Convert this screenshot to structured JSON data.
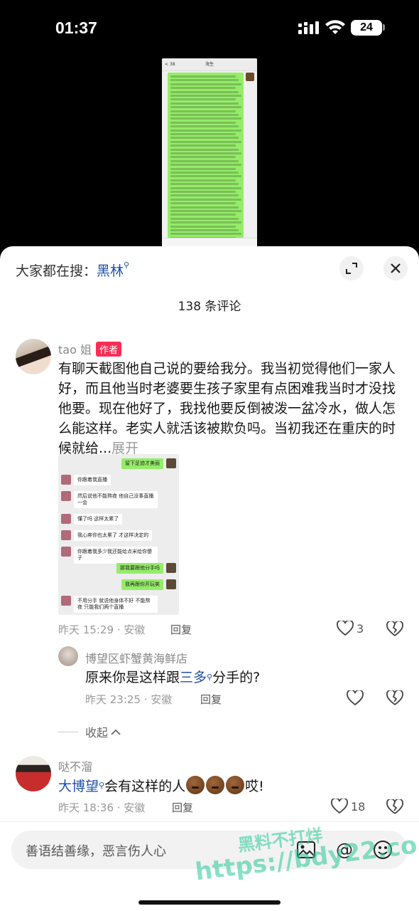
{
  "status": {
    "time": "01:37",
    "battery": "24"
  },
  "preview": {
    "title": "海生",
    "back": "< 38"
  },
  "sheet": {
    "search_prefix": "大家都在搜：",
    "search_keyword": "黑林",
    "comment_count": "138 条评论"
  },
  "comments": [
    {
      "user": "tao 姐",
      "badge": "作者",
      "text": "有聊天截图他自己说的要给我分。我当初觉得他们一家人好，而且他当时老婆要生孩子家里有点困难我当时才没找他要。现在他好了，我找他要反倒被泼一盆冷水，做人怎么能这样。老实人就活该被欺负吗。当初我还在重庆的时候就给...",
      "expand": "展开",
      "time_loc": "昨天 15:29 · 安徽",
      "reply": "回复",
      "likes": "3",
      "image_chat": [
        {
          "side": "right",
          "text": "留下足迹才美丽"
        },
        {
          "side": "left",
          "text": "你跟着我直播"
        },
        {
          "side": "left",
          "text": "然后说他不能熬夜 他自己没事直播一会"
        },
        {
          "side": "left",
          "text": "懂了吗 这样太累了"
        },
        {
          "side": "left",
          "text": "我心疼你也太累了 才这样决定的"
        },
        {
          "side": "left",
          "text": "你跟着我多少我还能给点米给你傻子"
        },
        {
          "side": "right",
          "text": "那我要跟他分手吗"
        },
        {
          "side": "right",
          "text": "我再跟你开玩笑"
        },
        {
          "side": "left",
          "text": "不用分手 就说他身体不好 不能熬夜 只能我们两个直播"
        }
      ]
    },
    {
      "user": "博望区虾蟹黄海鲜店",
      "text_prefix": "原来你是这样跟",
      "text_link": "三多",
      "text_suffix": "分手的?",
      "time_loc": "昨天 23:25 · 安徽",
      "reply": "回复"
    },
    {
      "user": "哒不溜",
      "text_link": "大博望",
      "text_mid": "会有这样的人",
      "text_suffix": "哎!",
      "time_loc": "昨天 18:36 · 安徽",
      "reply": "回复",
      "likes": "18"
    }
  ],
  "collapse": "收起",
  "input": {
    "placeholder": "善语结善缘，恶言伤人心"
  },
  "watermark": {
    "line1": "黑料不打烊",
    "line2": "https://bdy22.co"
  },
  "icons": {
    "expand": "expand-icon",
    "close": "close-icon",
    "heart": "heart-icon",
    "dislike": "broken-heart-icon",
    "image": "image-icon",
    "at": "at-icon",
    "emoji": "emoji-icon"
  }
}
